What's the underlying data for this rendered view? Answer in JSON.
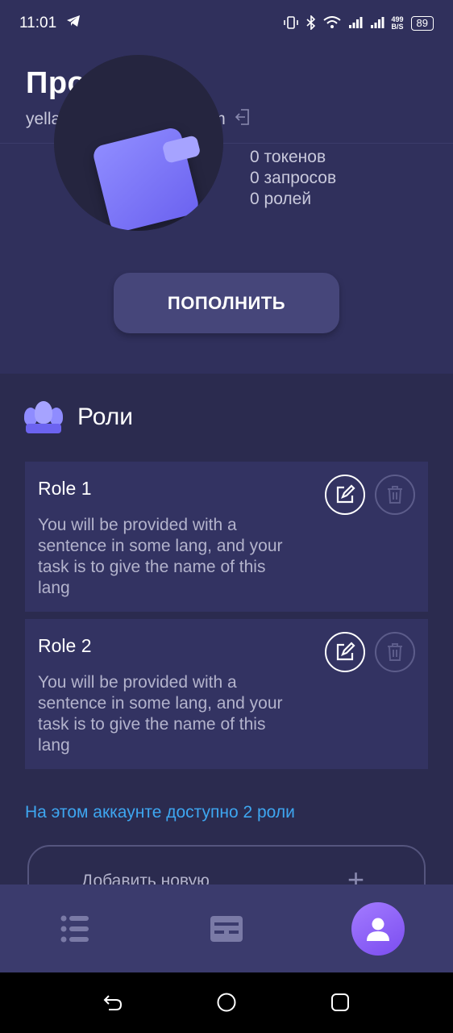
{
  "status_bar": {
    "time": "11:01",
    "net_speed": "499",
    "net_speed_unit": "B/S",
    "battery": "89"
  },
  "header": {
    "title": "Профиль",
    "email": "yellastronaut2@gmail.com"
  },
  "stats": {
    "tokens": "0 токенов",
    "requests": "0 запросов",
    "roles": "0 ролей"
  },
  "topup_label": "ПОПОЛНИТЬ",
  "roles_section": {
    "title": "Роли",
    "items": [
      {
        "title": "Role 1",
        "text": "You will be provided with a sentence in some lang, and your task is to give the name of this lang"
      },
      {
        "title": "Role 2",
        "text": "You will be provided with a sentence in some lang, and your task is to give the name of this lang"
      }
    ],
    "available_text": "На этом аккаунте доступно 2 роли",
    "add_role_label": "Добавить новую"
  },
  "icons": {
    "telegram": "telegram-icon",
    "logout": "logout-icon",
    "edit": "edit-icon",
    "delete": "trash-icon",
    "nav_list": "list-icon",
    "nav_cards": "cards-icon",
    "nav_profile": "user-icon"
  },
  "colors": {
    "accent": "#3ea6f0",
    "primary": "#8f8cff",
    "background": "#2b2b4f"
  }
}
